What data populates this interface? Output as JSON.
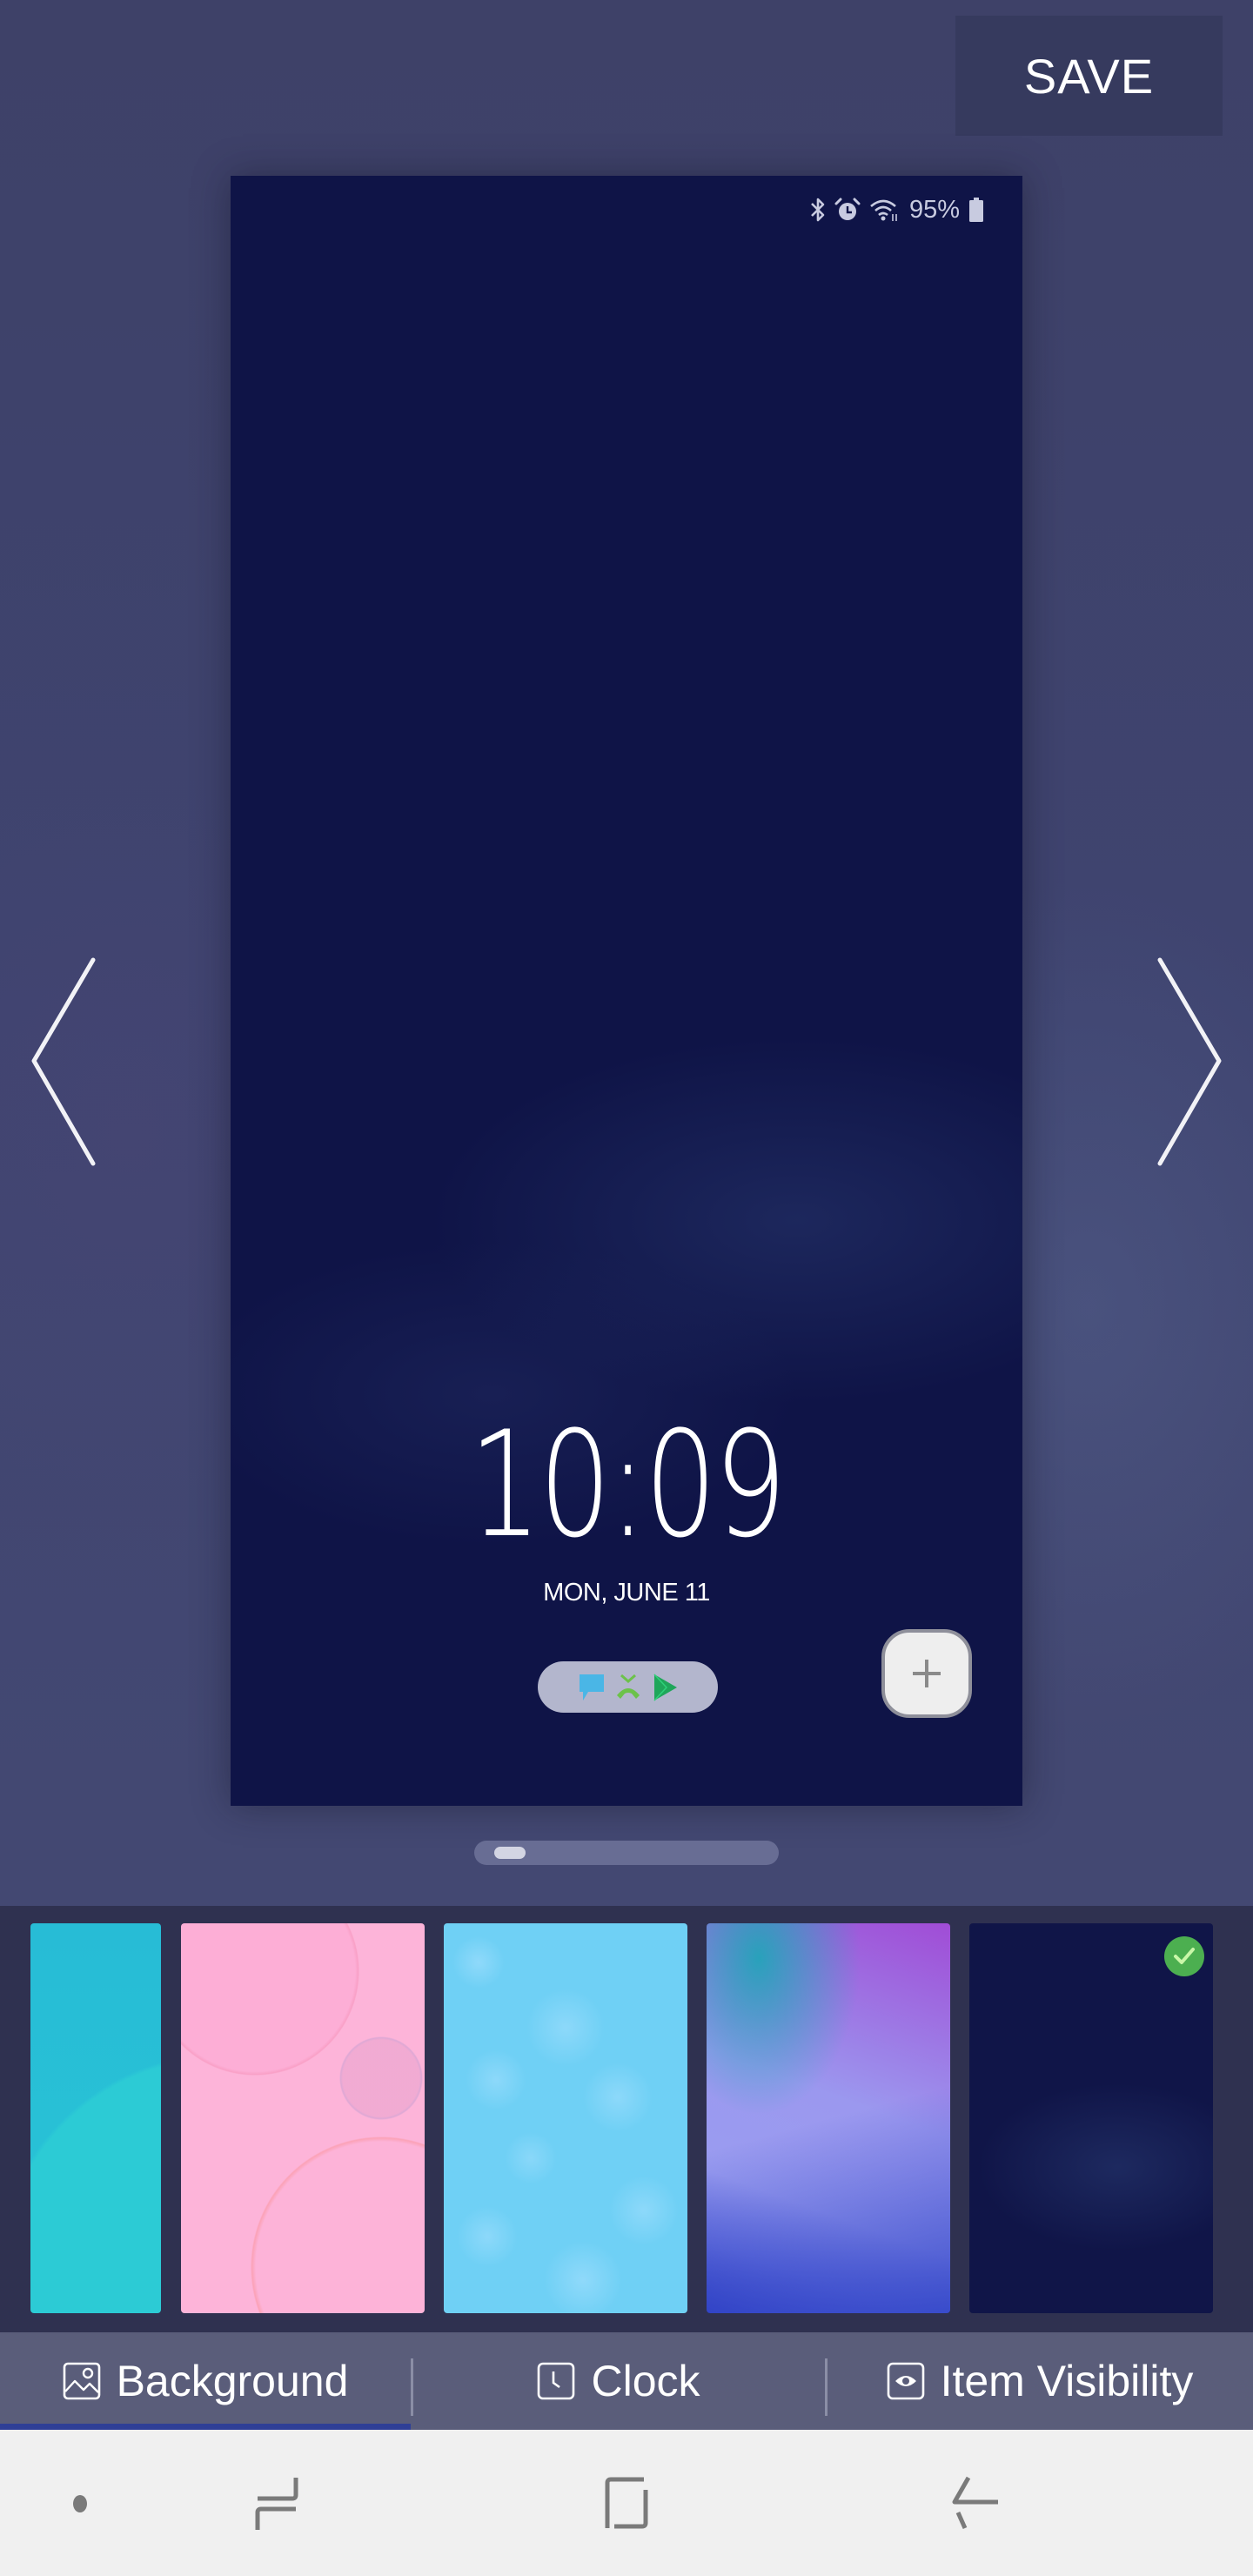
{
  "header": {
    "save_label": "SAVE"
  },
  "preview": {
    "status_bar": {
      "icons": [
        "bluetooth-icon",
        "alarm-icon",
        "wifi-icon",
        "battery-icon"
      ],
      "battery_percent": "95%"
    },
    "clock": {
      "time": "10:09",
      "date": "MON, JUNE 11"
    },
    "shortcuts": [
      "messages-icon",
      "missed-call-icon",
      "play-store-icon"
    ],
    "add_button_icon": "plus-icon"
  },
  "navigation": {
    "prev_icon": "chevron-left-icon",
    "next_icon": "chevron-right-icon"
  },
  "page_indicator": {
    "position_fraction": 0.05
  },
  "wallpapers": [
    {
      "name": "teal-wallpaper",
      "color": "#28c4d6",
      "selected": false
    },
    {
      "name": "pink-bubbles-wallpaper",
      "color": "#fdb4d9",
      "selected": false
    },
    {
      "name": "blue-bokeh-wallpaper",
      "color": "#6fd0f5",
      "selected": false
    },
    {
      "name": "purple-gradient-wallpaper",
      "color": "#9a9cf0",
      "selected": false
    },
    {
      "name": "dark-navy-wallpaper",
      "color": "#101548",
      "selected": true
    }
  ],
  "tabs": [
    {
      "label": "Background",
      "icon": "image-icon",
      "active": true
    },
    {
      "label": "Clock",
      "icon": "clock-icon",
      "active": false
    },
    {
      "label": "Item Visibility",
      "icon": "eye-icon",
      "active": false
    }
  ],
  "colors": {
    "accent": "#2f3f96",
    "selected_check": "#4caf50"
  },
  "system_nav": [
    "recents-dot",
    "recent-apps-icon",
    "home-icon",
    "back-icon"
  ]
}
